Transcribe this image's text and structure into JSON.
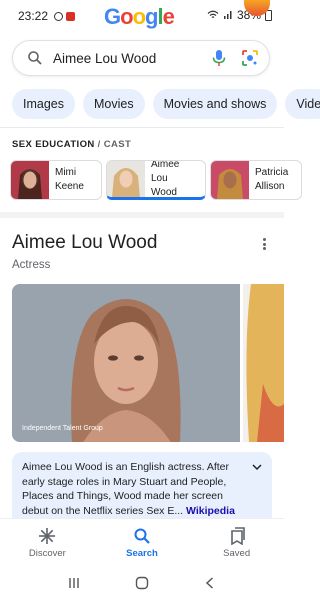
{
  "status_bar": {
    "time": "23:22",
    "battery": "38%"
  },
  "doodle": {
    "letters": [
      "G",
      "o",
      "o",
      "g",
      "l",
      "e"
    ]
  },
  "search": {
    "query": "Aimee Lou Wood"
  },
  "chips": [
    "Images",
    "Movies",
    "Movies and shows",
    "Vide"
  ],
  "cast": {
    "header_strong": "SEX EDUCATION",
    "header_light": " / CAST",
    "members": [
      {
        "first": "Mimi",
        "last": "Keene"
      },
      {
        "first": "Aimee Lou",
        "last": "Wood"
      },
      {
        "first": "Patricia",
        "last": "Allison"
      }
    ]
  },
  "entity": {
    "title": "Aimee Lou Wood",
    "subtitle": "Actress"
  },
  "photos": {
    "credit": "Independent Talent Group"
  },
  "description": {
    "text": "Aimee Lou Wood is an English actress. After early stage roles in Mary Stuart and People, Places and Things, Wood made her screen debut on the Netflix series Sex E... ",
    "link": "Wikipedia"
  },
  "bottom_nav": {
    "discover": "Discover",
    "search": "Search",
    "saved": "Saved"
  },
  "colors": {
    "accent": "#1a73e8",
    "chip_bg": "#e8f0fe"
  }
}
